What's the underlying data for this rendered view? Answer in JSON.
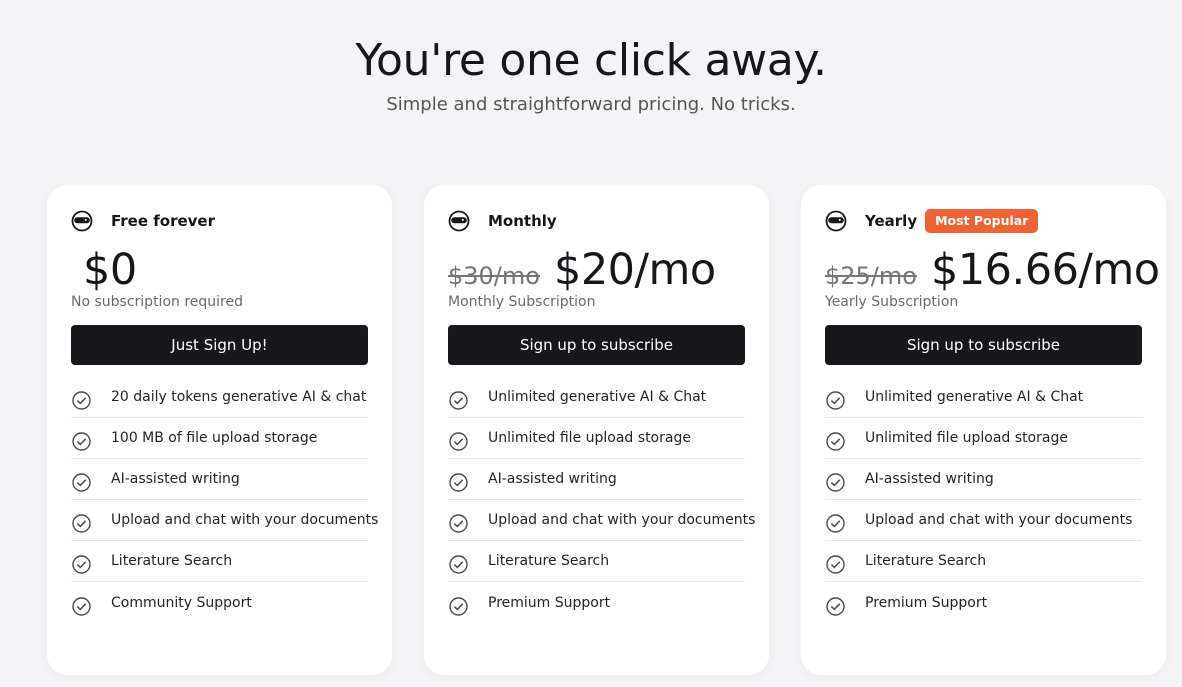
{
  "header": {
    "title": "You're one click away.",
    "subtitle": "Simple and straightforward pricing. No tricks."
  },
  "plans": [
    {
      "name": "Free forever",
      "icon": "helmet-icon",
      "badge": "",
      "old_price": "",
      "price": "$0",
      "caption": "No subscription required",
      "cta": "Just Sign Up!",
      "features": [
        "20 daily tokens generative AI & chat",
        "100 MB of file upload storage",
        "AI-assisted writing",
        "Upload and chat with your documents",
        "Literature Search",
        "Community Support"
      ]
    },
    {
      "name": "Monthly",
      "icon": "helmet-icon",
      "badge": "",
      "old_price": "$30/mo",
      "price": "$20/mo",
      "caption": "Monthly Subscription",
      "cta": "Sign up to subscribe",
      "features": [
        "Unlimited generative AI & Chat",
        "Unlimited file upload storage",
        "AI-assisted writing",
        "Upload and chat with your documents",
        "Literature Search",
        "Premium Support"
      ]
    },
    {
      "name": "Yearly",
      "icon": "helmet-icon",
      "badge": "Most Popular",
      "old_price": "$25/mo",
      "price": "$16.66/mo",
      "caption": "Yearly Subscription",
      "cta": "Sign up to subscribe",
      "features": [
        "Unlimited generative AI & Chat",
        "Unlimited file upload storage",
        "AI-assisted writing",
        "Upload and chat with your documents",
        "Literature Search",
        "Premium Support"
      ]
    }
  ],
  "colors": {
    "background": "#f4f4f6",
    "card": "#ffffff",
    "button": "#18181c",
    "badge": "#f06233",
    "text": "#17171b"
  }
}
